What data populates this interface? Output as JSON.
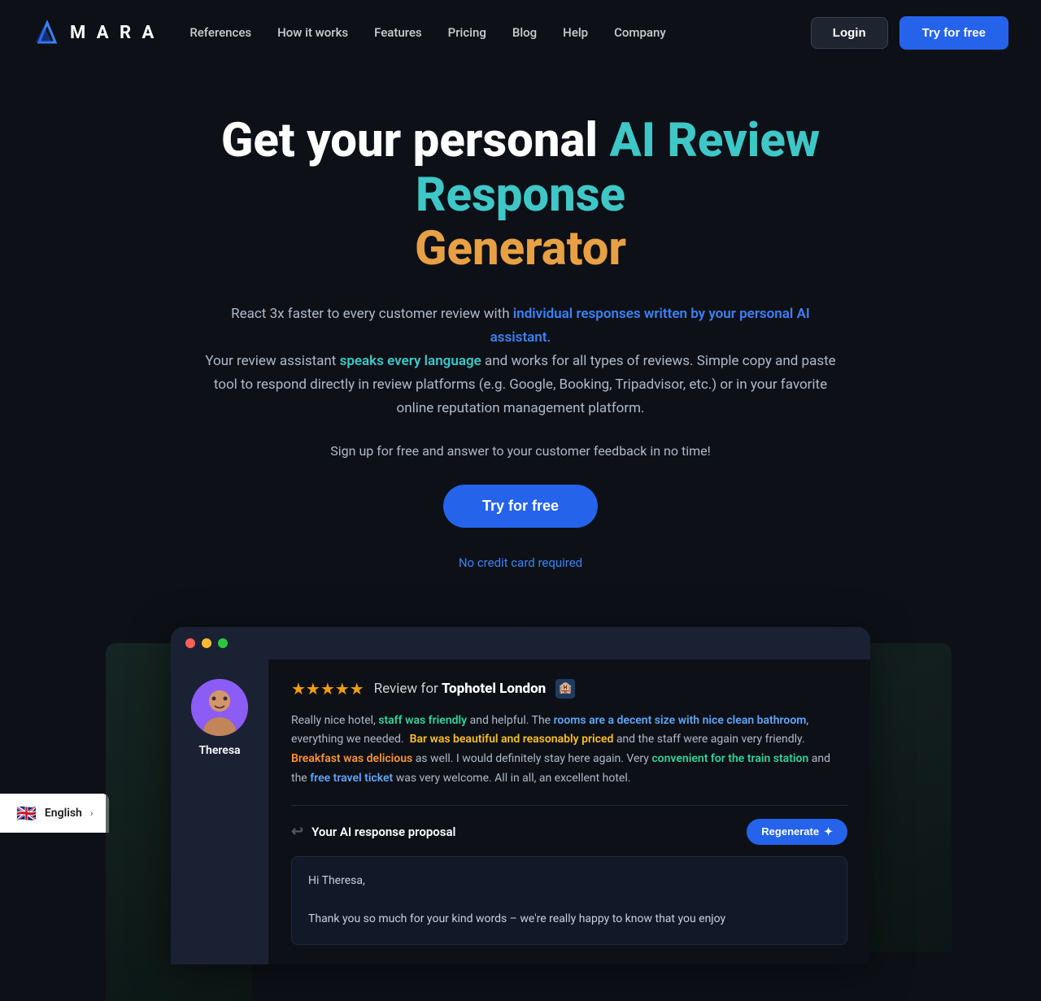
{
  "navbar": {
    "logo_text": "M A R A",
    "links": [
      {
        "label": "References",
        "id": "references"
      },
      {
        "label": "How it works",
        "id": "how-it-works"
      },
      {
        "label": "Features",
        "id": "features"
      },
      {
        "label": "Pricing",
        "id": "pricing"
      },
      {
        "label": "Blog",
        "id": "blog"
      },
      {
        "label": "Help",
        "id": "help"
      },
      {
        "label": "Company",
        "id": "company"
      }
    ],
    "login_label": "Login",
    "try_free_label": "Try for free"
  },
  "hero": {
    "title_part1": "Get your personal ",
    "title_part2": "AI Review Response",
    "title_part3": "Generator",
    "description1": "React 3x faster to every customer review with ",
    "description1_highlight": "individual responses written by your personal AI assistant.",
    "description2": " Your review assistant ",
    "description2_highlight": "speaks every language",
    "description3": " and works for all types of reviews. Simple copy and paste tool to respond directly in review platforms (e.g. Google, Booking, Tripadvisor, etc.) or in your favorite online reputation management platform.",
    "signup_text": "Sign up for free and answer to your customer feedback in no time!",
    "try_free_label": "Try for free",
    "no_credit_label": "No credit card required"
  },
  "demo": {
    "reviewer_name": "Theresa",
    "stars": "★★★★★",
    "review_for": "Review for ",
    "hotel_name": "Tophotel London",
    "review_text_parts": [
      {
        "text": "Really nice hotel, ",
        "type": "normal"
      },
      {
        "text": "staff was friendly",
        "type": "green"
      },
      {
        "text": " and helpful. The ",
        "type": "normal"
      },
      {
        "text": "rooms are a decent size with nice clean bathroom",
        "type": "blue"
      },
      {
        "text": ", everything we needed.  ",
        "type": "normal"
      },
      {
        "text": "Bar was beautiful and reasonably priced",
        "type": "yellow"
      },
      {
        "text": " and the staff were again very friendly. ",
        "type": "normal"
      },
      {
        "text": "Breakfast was delicious",
        "type": "orange"
      },
      {
        "text": " as well. I would definitely stay here again. Very ",
        "type": "normal"
      },
      {
        "text": "convenient for the train station",
        "type": "green"
      },
      {
        "text": " and the ",
        "type": "normal"
      },
      {
        "text": "free travel ticket",
        "type": "blue"
      },
      {
        "text": " was very welcome. All in all, an excellent hotel.",
        "type": "normal"
      }
    ],
    "ai_response_label": "Your AI response proposal",
    "regenerate_label": "Regenerate",
    "ai_response_text": "Hi Theresa,\n\nThank you so much for your kind words – we're really happy to know that you enjoy"
  },
  "language_bar": {
    "flag": "🇬🇧",
    "language": "English",
    "chevron": "›"
  }
}
